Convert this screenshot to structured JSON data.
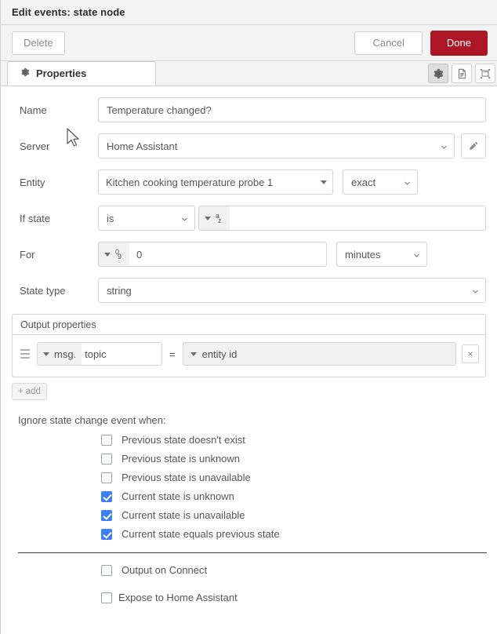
{
  "titlebar": {
    "title": "Edit events: state node"
  },
  "actionbar": {
    "delete_label": "Delete",
    "cancel_label": "Cancel",
    "done_label": "Done",
    "done_color": "#ad1625"
  },
  "tabs": {
    "properties_label": "Properties",
    "icons": [
      {
        "name": "gear-icon",
        "glyph": "⚙",
        "active": true
      },
      {
        "name": "description-icon",
        "glyph": "὜E",
        "active": false
      },
      {
        "name": "appearance-icon",
        "glyph": "⧉",
        "active": false
      }
    ]
  },
  "form": {
    "name": {
      "label": "Name",
      "value": "Temperature changed?",
      "placeholder": "Name"
    },
    "server": {
      "label": "Server",
      "value": "Home Assistant",
      "edit_icon": "pencil-icon"
    },
    "entity": {
      "label": "Entity",
      "value": "Kitchen cooking temperature probe 1",
      "match": "exact"
    },
    "if_state": {
      "label": "If state",
      "comparator": "is",
      "type_icon": "string-type-icon",
      "type_icon_top": "a",
      "type_icon_bottom": "z",
      "value": ""
    },
    "for": {
      "label": "For",
      "type_icon": "number-type-icon",
      "type_icon_top": "0",
      "type_icon_bottom": "9",
      "value": "0",
      "units": "minutes"
    },
    "state_type": {
      "label": "State type",
      "value": "string"
    }
  },
  "output_properties": {
    "panel_title": "Output properties",
    "rows": [
      {
        "prefix": "msg.",
        "property": "topic",
        "equals": "=",
        "value_type": "entity id",
        "remove_label": "×"
      }
    ],
    "add_label": "add",
    "add_icon": "plus-icon"
  },
  "ignore_section": {
    "title": "Ignore state change event when:",
    "items": [
      {
        "label": "Previous state doesn't exist",
        "checked": false
      },
      {
        "label": "Previous state is unknown",
        "checked": false
      },
      {
        "label": "Previous state is unavailable",
        "checked": false
      },
      {
        "label": "Current state is unknown",
        "checked": true
      },
      {
        "label": "Current state is unavailable",
        "checked": true
      },
      {
        "label": "Current state equals previous state",
        "checked": true
      }
    ],
    "checked_color": "#3b82f6"
  },
  "bottom_options": [
    {
      "label": "Output on Connect",
      "checked": false
    },
    {
      "label": "Expose to Home Assistant",
      "checked": false
    }
  ]
}
